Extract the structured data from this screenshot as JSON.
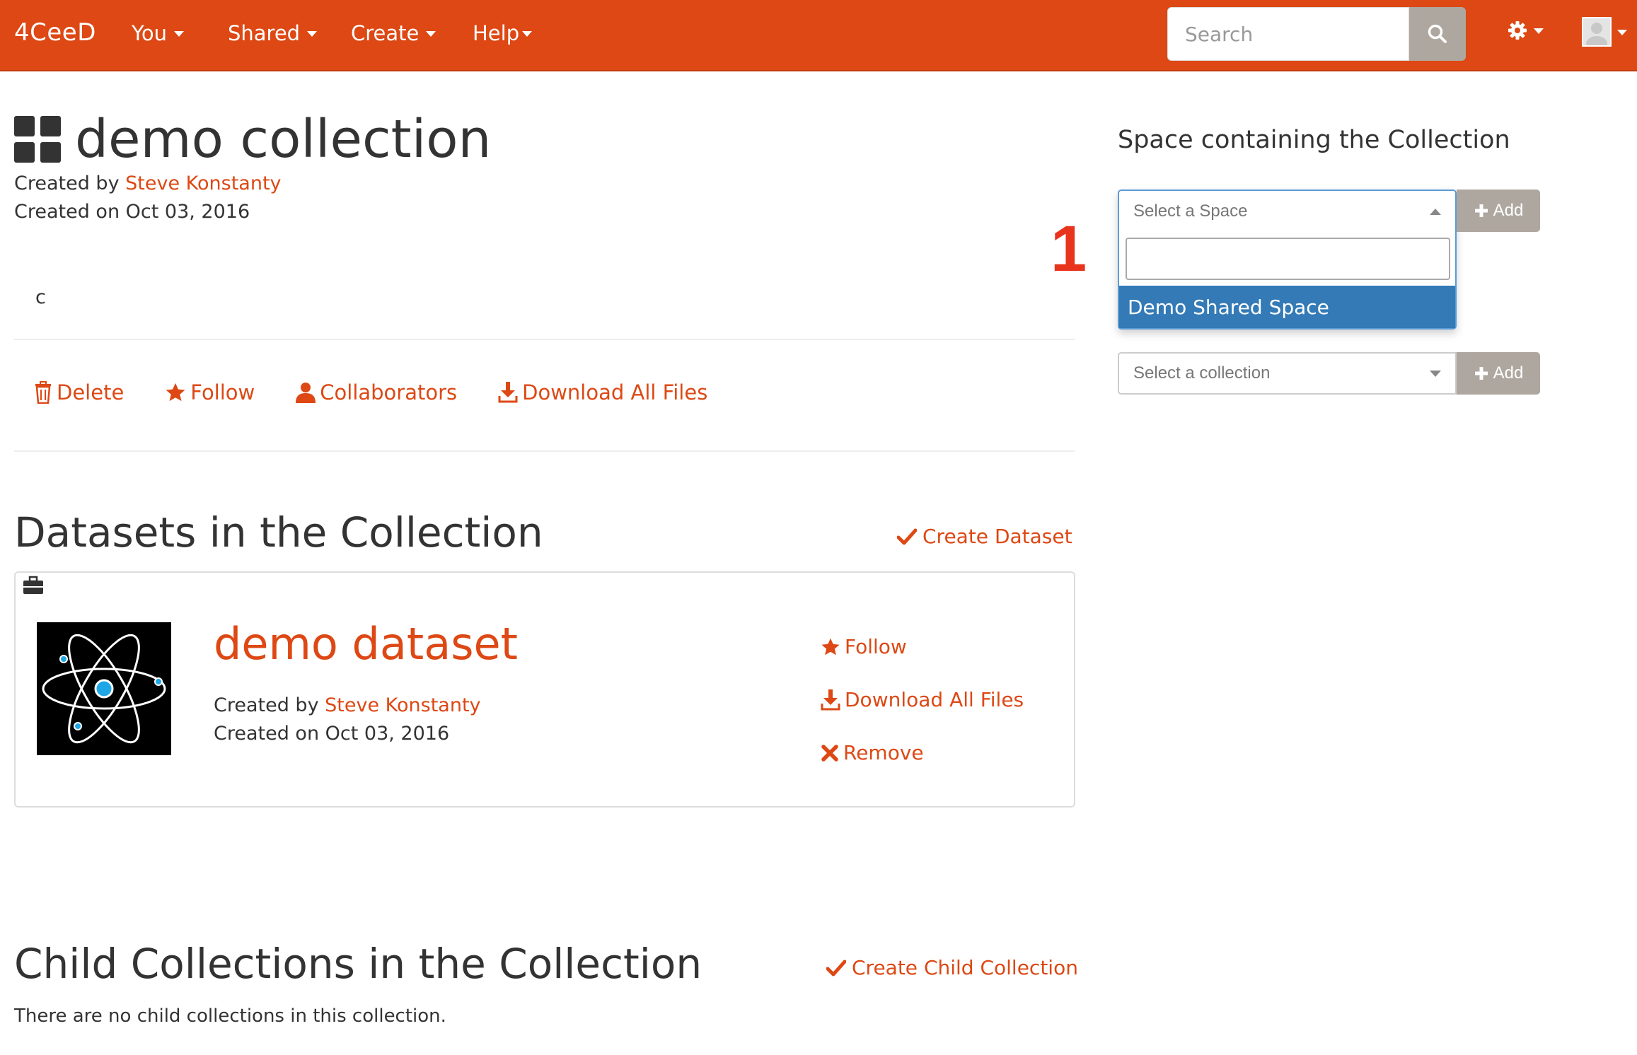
{
  "navbar": {
    "brand": "4CeeD",
    "menu": [
      {
        "label": "You"
      },
      {
        "label": "Shared"
      },
      {
        "label": "Create"
      },
      {
        "label": "Help"
      }
    ],
    "search_placeholder": "Search",
    "bg_color": "#DD4814"
  },
  "collection": {
    "title": "demo collection",
    "created_by_prefix": "Created by",
    "author": "Steve Konstanty",
    "created_on": "Created on Oct 03, 2016",
    "description": "c",
    "actions": {
      "delete": "Delete",
      "follow": "Follow",
      "collaborators": "Collaborators",
      "download": "Download All Files"
    }
  },
  "datasets_section": {
    "heading": "Datasets in the Collection",
    "create_label": "Create Dataset",
    "items": [
      {
        "title": "demo dataset",
        "created_by_prefix": "Created by",
        "author": "Steve Konstanty",
        "created_on": "Created on Oct 03, 2016",
        "actions": {
          "follow": "Follow",
          "download": "Download All Files",
          "remove": "Remove"
        }
      }
    ]
  },
  "child_section": {
    "heading": "Child Collections in the Collection",
    "create_label": "Create Child Collection",
    "empty_text": "There are no child collections in this collection."
  },
  "sidebar": {
    "title": "Space containing the Collection",
    "space_select": {
      "placeholder": "Select a Space",
      "search_value": "",
      "options": [
        "Demo Shared Space"
      ]
    },
    "collection_select": {
      "placeholder": "Select a collection"
    },
    "add_label": "Add"
  },
  "annotation": {
    "step": "1"
  },
  "colors": {
    "accent": "#DD4814",
    "button_gray": "#AEA79F",
    "selected_option": "#337ab7"
  }
}
